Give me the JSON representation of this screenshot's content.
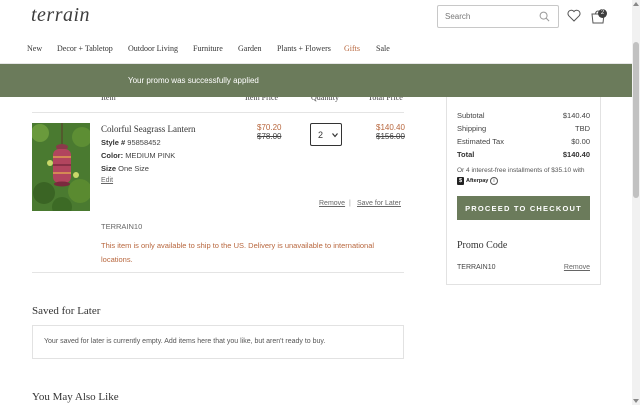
{
  "header": {
    "logo": "terrain",
    "search_placeholder": "Search",
    "cart_count": "2"
  },
  "nav": {
    "items": [
      "New",
      "Decor + Tabletop",
      "Outdoor Living",
      "Furniture",
      "Garden",
      "Plants + Flowers",
      "Gifts",
      "Sale"
    ]
  },
  "banner": {
    "message": "Your promo was successfully applied"
  },
  "cart": {
    "columns": [
      "Item",
      "Item Price",
      "Quantity",
      "Total Price"
    ],
    "item": {
      "name": "Colorful Seagrass Lantern",
      "style_label": "Style #",
      "style_value": "95858452",
      "color_label": "Color:",
      "color_value": "MEDIUM PINK",
      "size_label": "Size",
      "size_value": "One Size",
      "edit_label": "Edit",
      "sale_price": "$70.20",
      "original_price": "$78.00",
      "quantity": "2",
      "total_sale": "$140.40",
      "total_original": "$156.00",
      "remove_label": "Remove",
      "save_later_label": "Save for Later",
      "promo_code": "TERRAIN10",
      "shipping_message": "This item is only available to ship to the US. Delivery is unavailable to international locations."
    }
  },
  "saved_for_later": {
    "title": "Saved for Later",
    "empty_message": "Your saved for later is currently empty. Add items here that you like, but aren't ready to buy."
  },
  "you_may_also_like": {
    "title": "You May Also Like"
  },
  "summary": {
    "rows": [
      {
        "label": "Subtotal",
        "value": "$140.40"
      },
      {
        "label": "Shipping",
        "value": "TBD"
      },
      {
        "label": "Estimated Tax",
        "value": "$0.00"
      },
      {
        "label": "Total",
        "value": "$140.40"
      }
    ],
    "afterpay_text": "Or 4 interest-free installments of $35.10 with",
    "afterpay_brand": "Afterpay",
    "checkout_label": "PROCEED TO CHECKOUT",
    "promo_title": "Promo Code",
    "promo_applied": "TERRAIN10",
    "promo_remove": "Remove"
  },
  "colors": {
    "accent_green": "#6b7b5b",
    "sale_orange": "#b8673e"
  }
}
